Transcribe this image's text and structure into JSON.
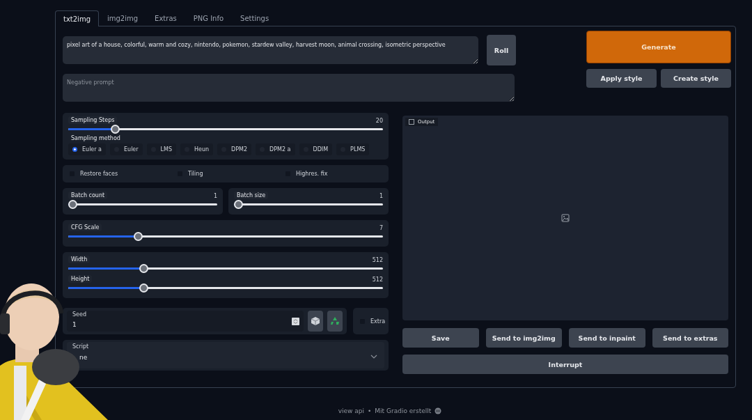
{
  "tabs": [
    {
      "label": "txt2img",
      "selected": true
    },
    {
      "label": "img2img",
      "selected": false
    },
    {
      "label": "Extras",
      "selected": false
    },
    {
      "label": "PNG Info",
      "selected": false
    },
    {
      "label": "Settings",
      "selected": false
    }
  ],
  "prompt": {
    "value": "pixel art of a house, colorful, warm and cozy, nintendo, pokemon, stardew valley, harvest moon, animal crossing, isometric perspective"
  },
  "negative_prompt": {
    "placeholder": "Negative prompt"
  },
  "roll_button": "Roll",
  "generate_button": "Generate",
  "style_buttons": [
    "Apply style",
    "Create style"
  ],
  "sampling_steps": {
    "label": "Sampling Steps",
    "reading": "20",
    "level": 0.14
  },
  "sampling_method": {
    "label": "Sampling method",
    "options": [
      {
        "label": "Euler a",
        "selected": true
      },
      {
        "label": "Euler",
        "selected": false
      },
      {
        "label": "LMS",
        "selected": false
      },
      {
        "label": "Heun",
        "selected": false
      },
      {
        "label": "DPM2",
        "selected": false
      },
      {
        "label": "DPM2 a",
        "selected": false
      },
      {
        "label": "DDIM",
        "selected": false
      },
      {
        "label": "PLMS",
        "selected": false
      }
    ]
  },
  "options": [
    {
      "label": "Restore faces",
      "checked": false
    },
    {
      "label": "Tiling",
      "checked": false
    },
    {
      "label": "Highres. fix",
      "checked": false
    }
  ],
  "batch": [
    {
      "label": "Batch count",
      "reading": "1",
      "level": 0
    },
    {
      "label": "Batch size",
      "reading": "1",
      "level": 0
    }
  ],
  "cfg_scale": {
    "label": "CFG Scale",
    "reading": "7",
    "level": 0.215
  },
  "size": [
    {
      "label": "Width",
      "reading": "512",
      "level": 0.233
    },
    {
      "label": "Height",
      "reading": "512",
      "level": 0.233
    }
  ],
  "seed": {
    "label": "Seed",
    "value": "1"
  },
  "extra": {
    "label": "Extra",
    "checked": false
  },
  "script": {
    "label": "Script",
    "value": "ne"
  },
  "output": {
    "label": "Output"
  },
  "output_buttons": [
    "Save",
    "Send to img2img",
    "Send to inpaint",
    "Send to extras"
  ],
  "interrupt_button": "Interrupt",
  "footer": {
    "link": "view api",
    "separator": "•",
    "credit": "Mit Gradio erstellt"
  }
}
